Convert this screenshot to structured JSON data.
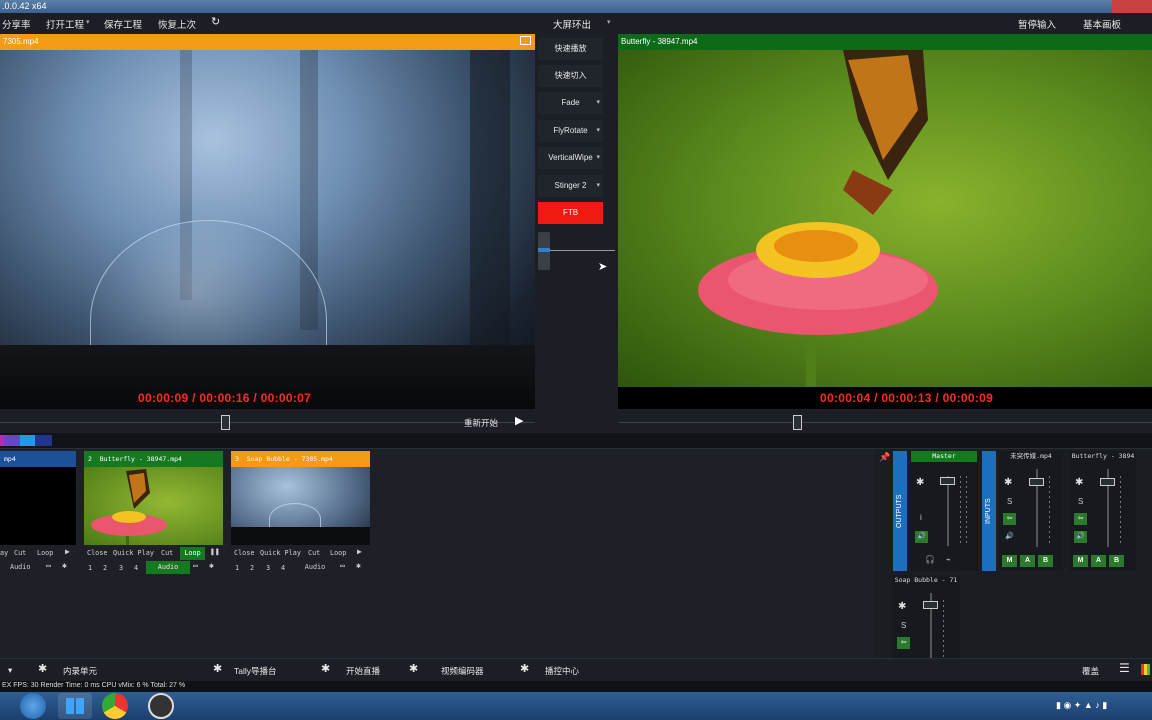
{
  "window": {
    "title": ".0.0.42 x64"
  },
  "menu": {
    "items": [
      "分享率",
      "打开工程",
      "保存工程",
      "恢复上次"
    ],
    "center": "大屏环出",
    "right": [
      "暂停输入",
      "基本画板"
    ]
  },
  "preview": {
    "title": "7305.mp4",
    "timecode": "00:00:09  /  00:00:16  /  00:00:07"
  },
  "transitions": {
    "buttons": [
      "快速播放",
      "快速切入",
      "Fade",
      "FlyRotate",
      "VerticalWipe",
      "Stinger 2"
    ],
    "ftb": "FTB"
  },
  "output": {
    "title": "Butterfly - 38947.mp4",
    "timecode": "00:00:04  /  00:00:13  /  00:00:09"
  },
  "seek": {
    "restart": "重新开始"
  },
  "inputs": [
    {
      "number": "",
      "title": "mp4",
      "color": "#1e4f9a",
      "controls": [
        "ay",
        "Cut",
        "Loop"
      ],
      "audio": "Audio"
    },
    {
      "number": "2",
      "title": "Butterfly - 38947.mp4",
      "color": "#15791f",
      "controls": [
        "Close",
        "Quick Play",
        "Cut",
        "Loop"
      ],
      "nums": [
        "1",
        "2",
        "3",
        "4"
      ],
      "audio": "Audio"
    },
    {
      "number": "3",
      "title": "Soap Bubble - 7305.mp4",
      "color": "#f49a17",
      "controls": [
        "Close",
        "Quick Play",
        "Cut",
        "Loop"
      ],
      "nums": [
        "1",
        "2",
        "3",
        "4"
      ],
      "audio": "Audio"
    }
  ],
  "mixer": {
    "outputs_label": "OUTPUTS",
    "inputs_label": "INPUTS",
    "master": "Master",
    "channels": [
      "未突传媒.mp4",
      "Butterfly - 3894",
      "Soap Bubble - 71"
    ],
    "mab": [
      "M",
      "A",
      "B"
    ],
    "solo": "S",
    "info": "i"
  },
  "bottom": {
    "items": [
      "内录单元",
      "Tally导播台",
      "开始直播",
      "视频编码器",
      "播控中心"
    ],
    "right": "覆盖"
  },
  "status": "EX  FPS: 30  Render Time: 0 ms  CPU vMix: 6 %  Total: 27 %"
}
